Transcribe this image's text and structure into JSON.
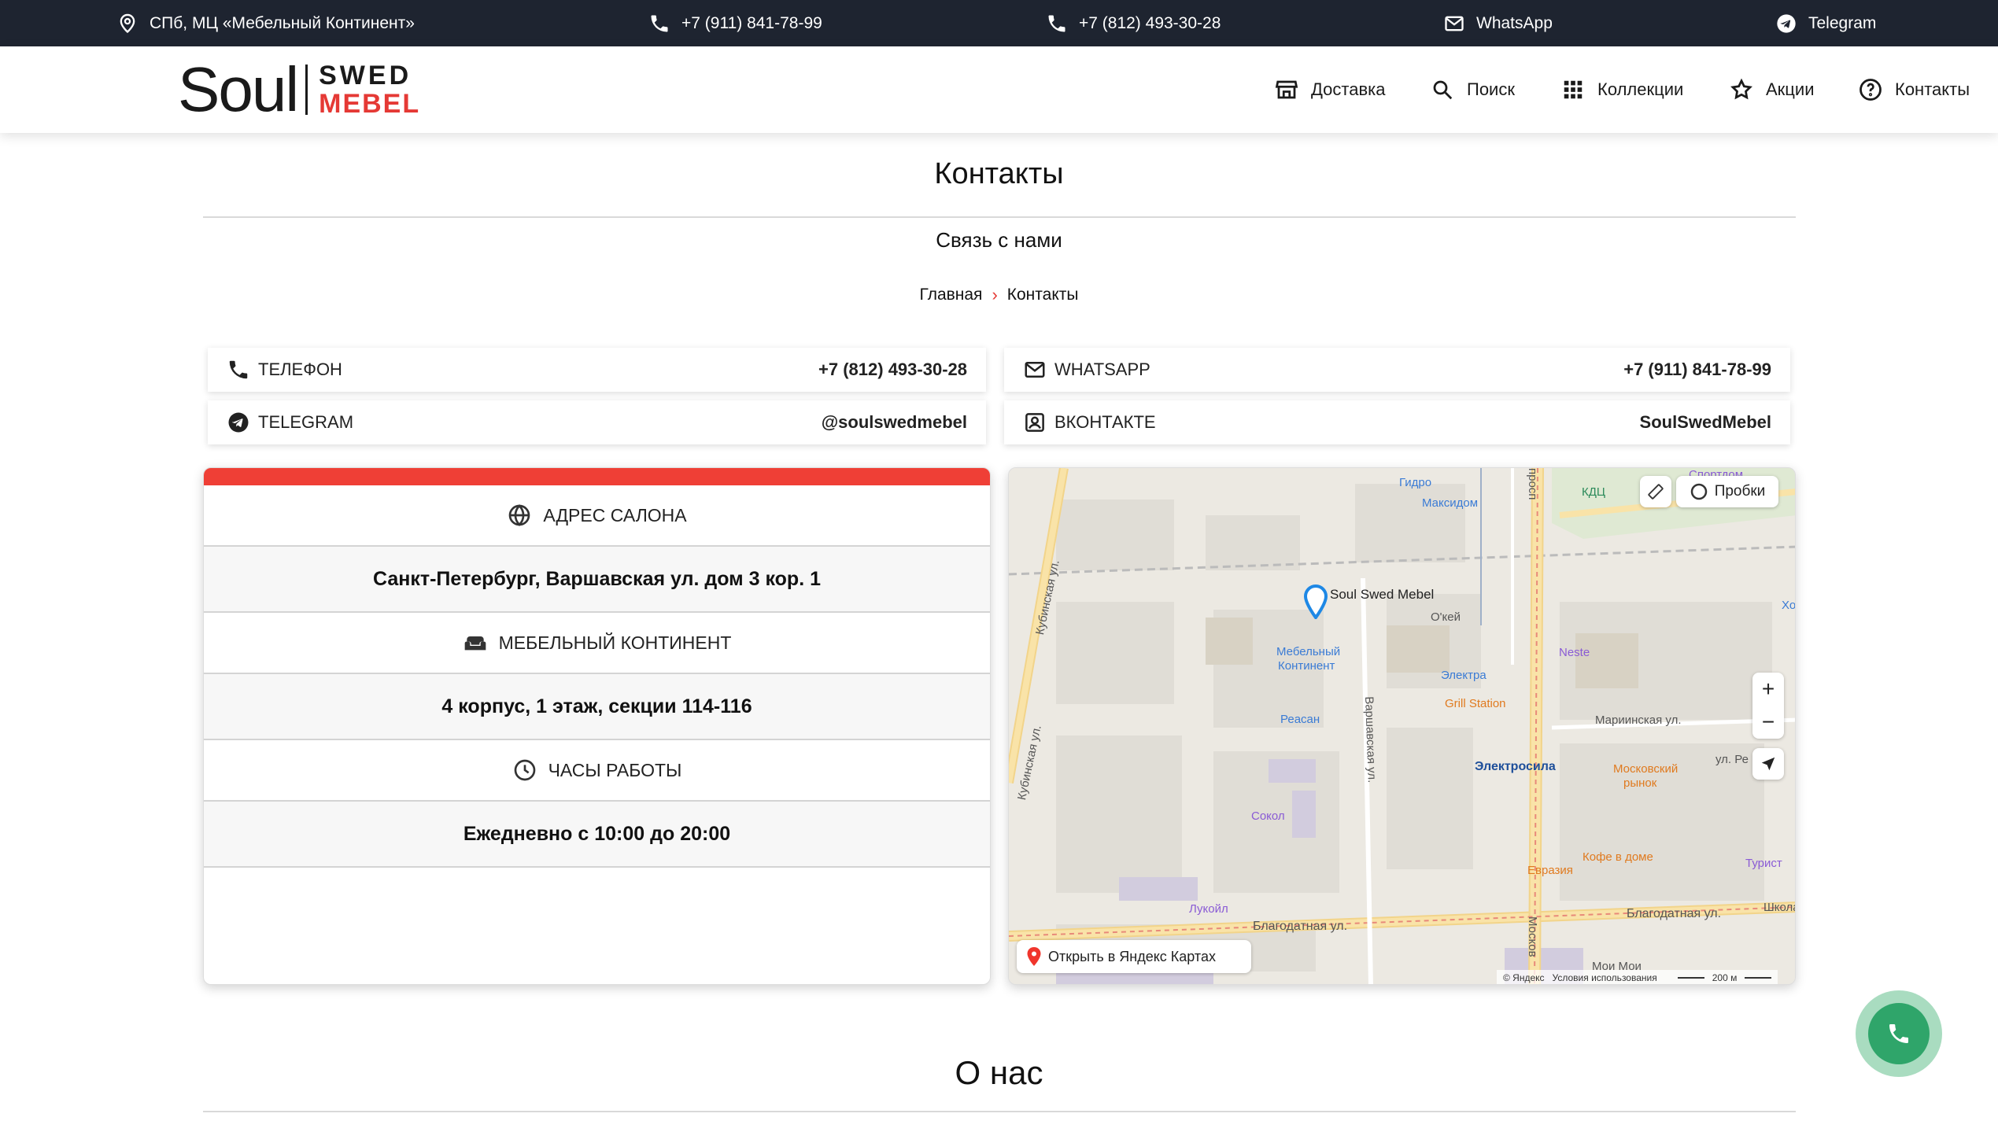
{
  "topbar": {
    "address": "СПб, МЦ «Мебельный Континент»",
    "phone1": "+7 (911) 841-78-99",
    "phone2": "+7 (812) 493-30-28",
    "whatsapp": "WhatsApp",
    "telegram": "Telegram"
  },
  "logo": {
    "soul": "Soul",
    "swed": "SWED",
    "mebel": "MEBEL"
  },
  "nav": {
    "delivery": "Доставка",
    "search": "Поиск",
    "collections": "Коллекции",
    "sales": "Акции",
    "contacts": "Контакты"
  },
  "page": {
    "title": "Контакты",
    "subtitle": "Связь с нами",
    "breadcrumb_home": "Главная",
    "breadcrumb_sep": "›",
    "breadcrumb_current": "Контакты",
    "about_title": "О нас"
  },
  "contacts": {
    "phone_label": "Телефон",
    "phone_value": "+7 (812) 493-30-28",
    "whatsapp_label": "WhatsApp",
    "whatsapp_value": "+7 (911) 841-78-99",
    "telegram_label": "Telegram",
    "telegram_value": "@soulswedmebel",
    "vk_label": "ВКонтакте",
    "vk_value": "SoulSwedMebel"
  },
  "salon": {
    "address_head": "Адрес салона",
    "address_value": "Санкт-Петербург, Варшавская ул. дом 3 кор. 1",
    "mall_head": "Мебельный континент",
    "mall_value": "4 корпус, 1 этаж, секции 114-116",
    "hours_head": "Часы работы",
    "hours_value": "Ежедневно с 10:00 до 20:00"
  },
  "map": {
    "marker": "Soul Swed Mebel",
    "traffic": "Пробки",
    "open_in": "Открыть в Яндекс Картах",
    "copyright": "© Яндекс",
    "terms": "Условия использования",
    "scale": "200 м",
    "zoom_in": "+",
    "zoom_out": "−",
    "places": {
      "gidro": "Гидро",
      "maksidom": "Максидом",
      "okey": "О'кей",
      "mebelnyi": "Мебельный",
      "kontinent": "Континент",
      "elektra": "Электра",
      "neste": "Neste",
      "grill": "Grill Station",
      "reasan": "Реасан",
      "elektrosila": "Электросила",
      "mosrynok1": "Московский",
      "mosrynok2": "рынок",
      "sokol": "Сокол",
      "evraziya": "Евразия",
      "kofe": "Кофе в доме",
      "turist": "Турист",
      "lukoil": "Лукойл",
      "kdc": "КДЦ",
      "sportdom": "Спортдом",
      "ho": "Хо",
      "kubinskaya": "Кубинская ул.",
      "kubinskaya2": "Кубинская ул.",
      "varshavskaya": "Варшавская ул.",
      "marinskaya": "Мариинская ул.",
      "blagodatnaya1": "Благодатная ул.",
      "blagodatnaya2": "Благодатная ул.",
      "moskov": "Москов",
      "prosp": "просп",
      "ulre": "ул. Ре",
      "shkola": "Школа",
      "moimoi": "Мои Мои"
    }
  }
}
